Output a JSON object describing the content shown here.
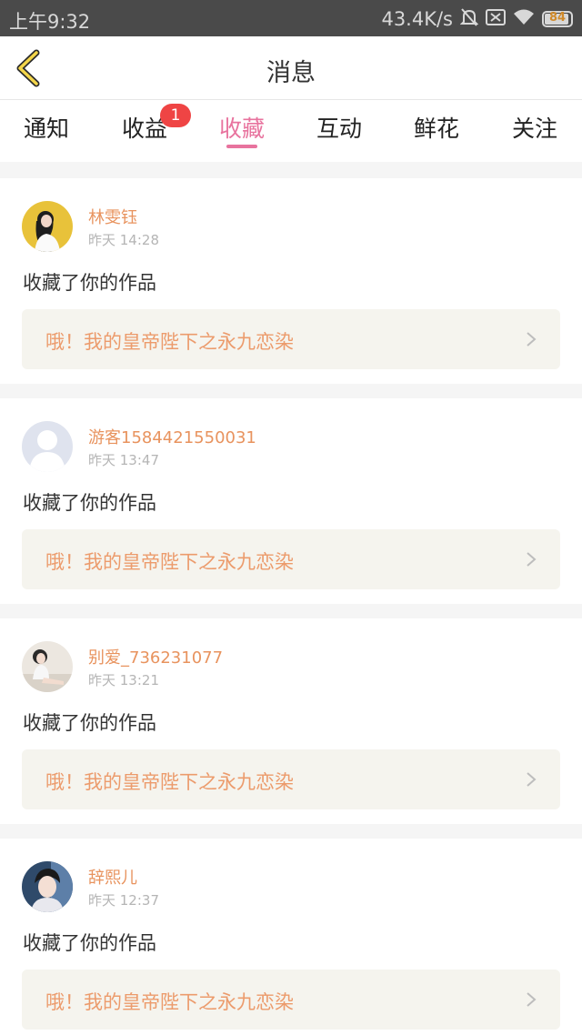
{
  "status_bar": {
    "time": "上午9:32",
    "network_speed": "43.4K/s",
    "battery_level": "84",
    "icons": [
      "bell-muted-icon",
      "sim-icon",
      "wifi-icon",
      "battery-icon"
    ]
  },
  "navbar": {
    "title": "消息",
    "back_icon": "chevron-left-icon"
  },
  "tabs": [
    {
      "label": "通知",
      "active": false
    },
    {
      "label": "收益",
      "active": false,
      "badge": "1"
    },
    {
      "label": "收藏",
      "active": true
    },
    {
      "label": "互动",
      "active": false
    },
    {
      "label": "鲜花",
      "active": false
    },
    {
      "label": "关注",
      "active": false
    }
  ],
  "colors": {
    "accent": "#e8739e",
    "name": "#e8935e",
    "work_title": "#ec9b6c",
    "badge": "#ef4444"
  },
  "messages": [
    {
      "name": "林雯钰",
      "time": "昨天 14:28",
      "action": "收藏了你的作品",
      "work": "哦！我的皇帝陛下之永九恋染",
      "avatar": "photo-girl-yellow"
    },
    {
      "name": "游客1584421550031",
      "time": "昨天 13:47",
      "action": "收藏了你的作品",
      "work": "哦！我的皇帝陛下之永九恋染",
      "avatar": "default-user"
    },
    {
      "name": "别爱_736231077",
      "time": "昨天 13:21",
      "action": "收藏了你的作品",
      "work": "哦！我的皇帝陛下之永九恋染",
      "avatar": "photo-girl-sitting"
    },
    {
      "name": "辞熙儿",
      "time": "昨天 12:37",
      "action": "收藏了你的作品",
      "work": "哦！我的皇帝陛下之永九恋染",
      "avatar": "photo-boy"
    }
  ]
}
